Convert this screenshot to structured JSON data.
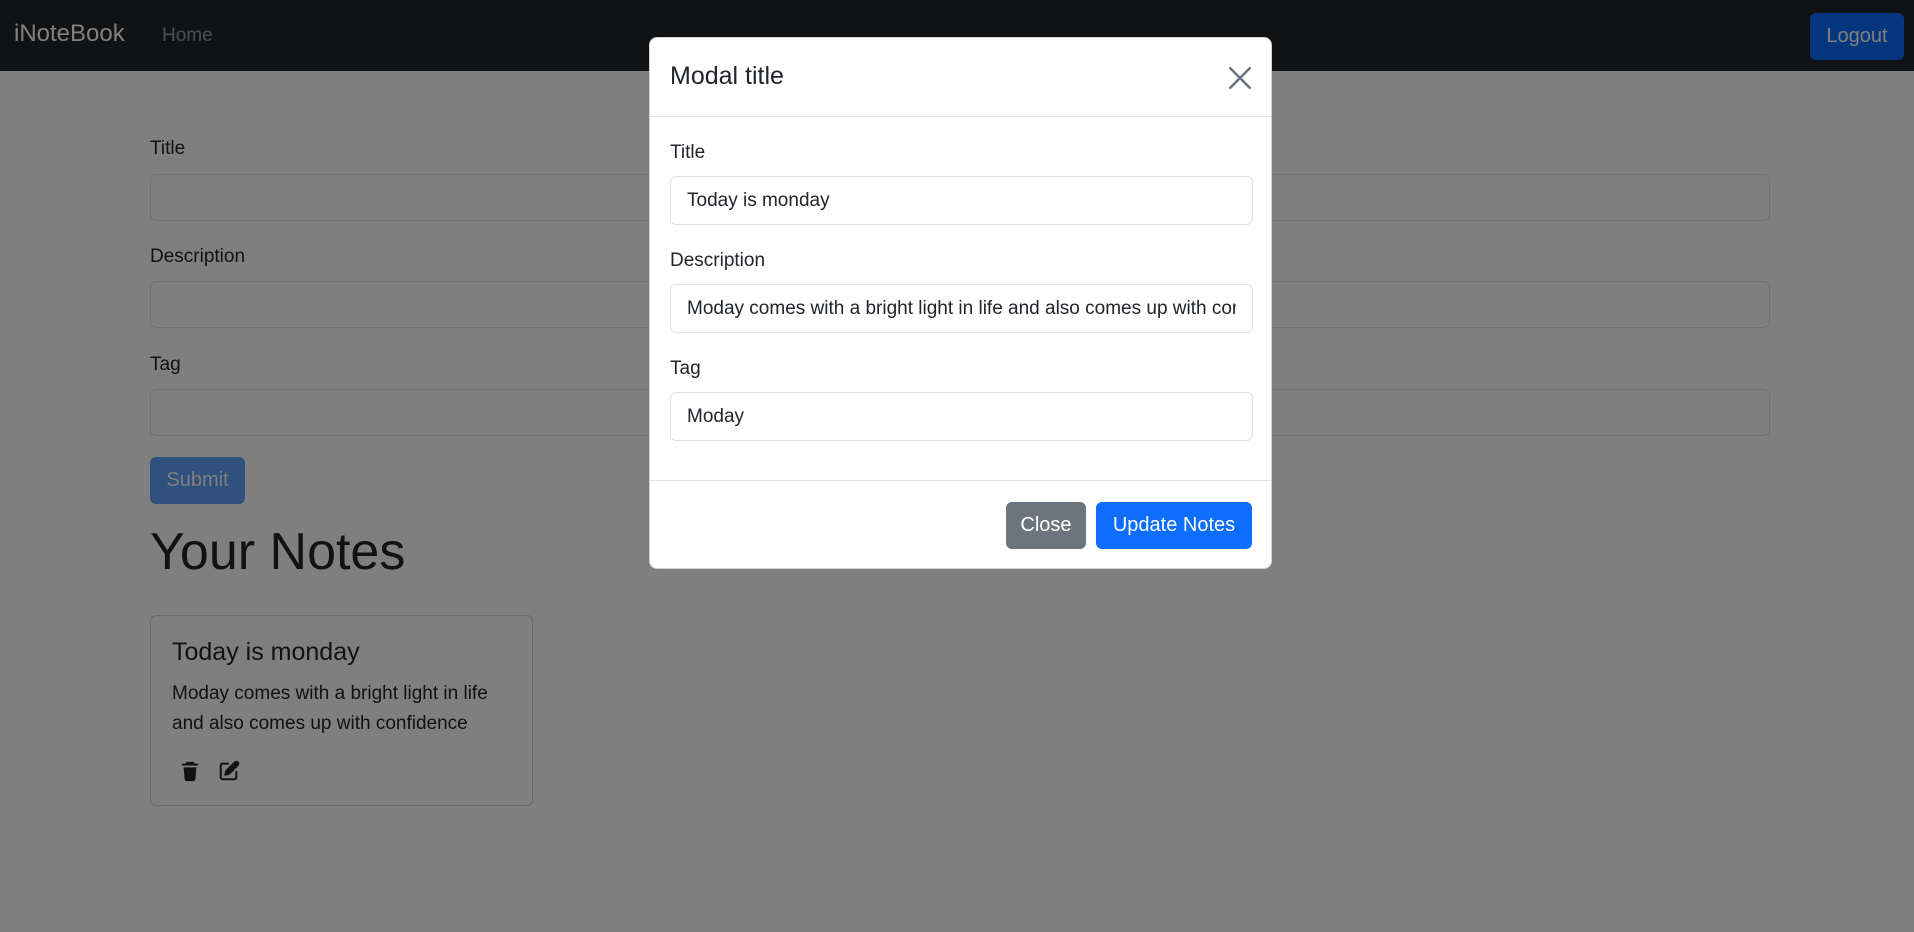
{
  "navbar": {
    "brand": "iNoteBook",
    "home_label": "Home",
    "logout_label": "Logout"
  },
  "form": {
    "title_label": "Title",
    "title_value": "",
    "description_label": "Description",
    "description_value": "",
    "tag_label": "Tag",
    "tag_value": "",
    "submit_label": "Submit"
  },
  "notes": {
    "heading": "Your Notes",
    "items": [
      {
        "title": "Today is monday",
        "description": "Moday comes with a bright light in life and also comes up with confidence"
      }
    ]
  },
  "modal": {
    "title": "Modal title",
    "title_label": "Title",
    "title_value": "Today is monday",
    "description_label": "Description",
    "description_value": "Moday comes with a bright light in life and also comes up with confidence",
    "tag_label": "Tag",
    "tag_value": "Moday",
    "close_label": "Close",
    "update_label": "Update Notes"
  },
  "colors": {
    "navbar_bg": "#212529",
    "primary": "#0d6efd",
    "secondary": "#6c757d",
    "backdrop": "rgba(0,0,0,0.5)"
  },
  "icons": {
    "note_delete": "trash-icon",
    "note_edit": "edit-icon",
    "modal_close": "close-icon"
  }
}
